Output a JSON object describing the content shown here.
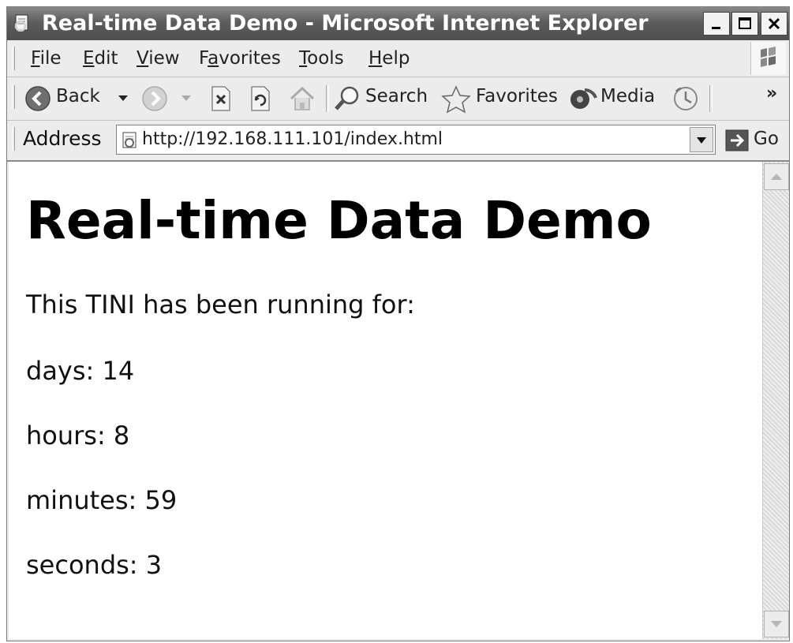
{
  "window": {
    "title": "Real-time Data Demo - Microsoft Internet Explorer"
  },
  "menu": {
    "items": [
      {
        "accel": "F",
        "rest": "ile"
      },
      {
        "accel": "E",
        "rest": "dit"
      },
      {
        "accel": "V",
        "rest": "iew"
      },
      {
        "pre": "F",
        "accel": "a",
        "rest": "vorites"
      },
      {
        "accel": "T",
        "rest": "ools"
      },
      {
        "accel": "H",
        "rest": "elp"
      }
    ]
  },
  "toolbar": {
    "back_label": "Back",
    "search_label": "Search",
    "favorites_label": "Favorites",
    "media_label": "Media",
    "more_label": "»"
  },
  "address": {
    "label": "Address",
    "url": "http://192.168.111.101/index.html",
    "go_label": "Go"
  },
  "page": {
    "heading": "Real-time Data Demo",
    "intro": "This TINI has been running for:",
    "days": "days: 14",
    "hours": "hours: 8",
    "minutes": "minutes: 59",
    "seconds": "seconds: 3"
  },
  "colors": {
    "titlebar": "#5d5d5d",
    "chrome": "#ececec",
    "content_bg": "#ffffff"
  }
}
